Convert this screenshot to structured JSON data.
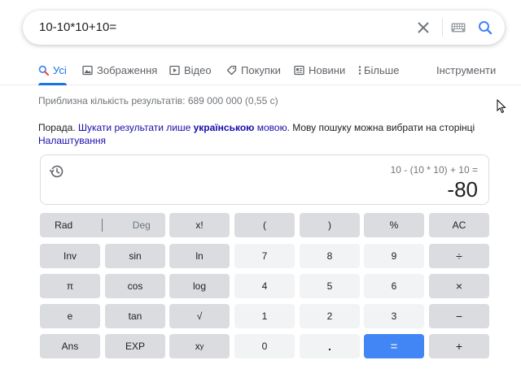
{
  "search": {
    "query": "10-10*10+10="
  },
  "tabs": [
    {
      "label": "Усі",
      "icon": "search-icon",
      "active": true
    },
    {
      "label": "Зображення",
      "icon": "image-icon"
    },
    {
      "label": "Відео",
      "icon": "video-icon"
    },
    {
      "label": "Покупки",
      "icon": "tag-icon"
    },
    {
      "label": "Новини",
      "icon": "news-icon"
    },
    {
      "label": "Більше",
      "icon": "more-vert-icon"
    }
  ],
  "tools_label": "Інструменти",
  "result_stats": "Приблизна кількість результатів: 689 000 000 (0,55 с)",
  "tip": {
    "prefix": "Порада. ",
    "link1_a": "Шукати результати лише ",
    "link1_bold": "українською",
    "link1_b": " мовою",
    "middle": ". Мову пошуку можна вибрати на сторінці ",
    "settings_link": "Налаштування"
  },
  "calculator": {
    "expression": "10 - (10 * 10) + 10 =",
    "result": "-80",
    "rad_label": "Rad",
    "deg_label": "Deg",
    "keys": {
      "fact": "x!",
      "lparen": "(",
      "rparen": ")",
      "percent": "%",
      "ac": "AC",
      "inv": "Inv",
      "sin": "sin",
      "ln": "ln",
      "k7": "7",
      "k8": "8",
      "k9": "9",
      "div": "÷",
      "pi": "π",
      "cos": "cos",
      "log": "log",
      "k4": "4",
      "k5": "5",
      "k6": "6",
      "mul": "×",
      "e": "e",
      "tan": "tan",
      "sqrt": "√",
      "k1": "1",
      "k2": "2",
      "k3": "3",
      "minus": "−",
      "ans": "Ans",
      "exp": "EXP",
      "pow_base": "x",
      "pow_exp": "y",
      "k0": "0",
      "dot": ".",
      "eq": "=",
      "plus": "+"
    },
    "accent": "#4285f4"
  }
}
